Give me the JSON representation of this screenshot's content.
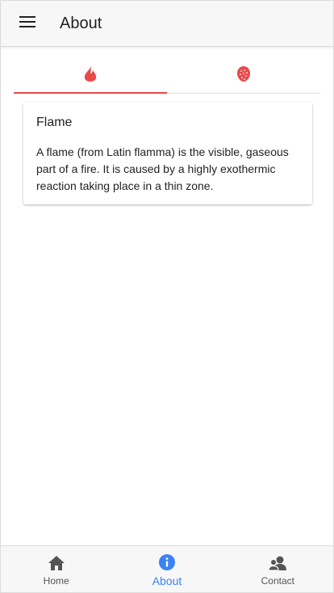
{
  "appbar": {
    "title": "About",
    "menu_icon": "menu-icon"
  },
  "tabs": [
    {
      "icon": "flame-icon",
      "active": true
    },
    {
      "icon": "strawberry-icon",
      "active": false
    }
  ],
  "card": {
    "title": "Flame",
    "text": "A flame (from Latin flamma) is the visible, gaseous part of a fire. It is caused by a highly exothermic reaction taking place in a thin zone."
  },
  "bottom_nav": {
    "items": [
      {
        "label": "Home",
        "icon": "home-icon",
        "active": false
      },
      {
        "label": "About",
        "icon": "info-icon",
        "active": true
      },
      {
        "label": "Contact",
        "icon": "contacts-icon",
        "active": false
      }
    ]
  },
  "colors": {
    "accent": "#e84a4a",
    "active_nav": "#3b82f6"
  }
}
